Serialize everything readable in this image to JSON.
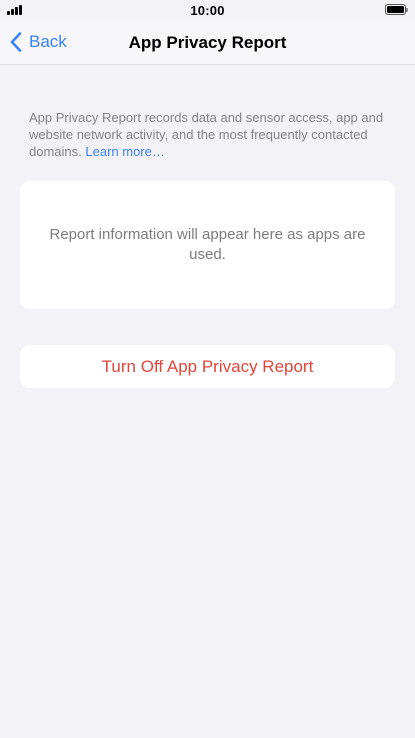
{
  "status_bar": {
    "time": "10:00"
  },
  "nav": {
    "back_label": "Back",
    "title": "App Privacy Report"
  },
  "intro": {
    "text": "App Privacy Report records data and sensor access, app and website network activity, and the most frequently contacted domains.",
    "link": "Learn more…"
  },
  "info_card": {
    "text": "Report information will appear here as apps are used."
  },
  "action": {
    "label": "Turn Off App Privacy Report"
  },
  "colors": {
    "background": "#f2f2f7",
    "accent": "#3a82f7",
    "destructive": "#e0463b",
    "secondary_text": "#838388"
  },
  "icons": {
    "signal": "cellular-signal-icon",
    "battery": "battery-icon",
    "back": "chevron-left-icon"
  }
}
